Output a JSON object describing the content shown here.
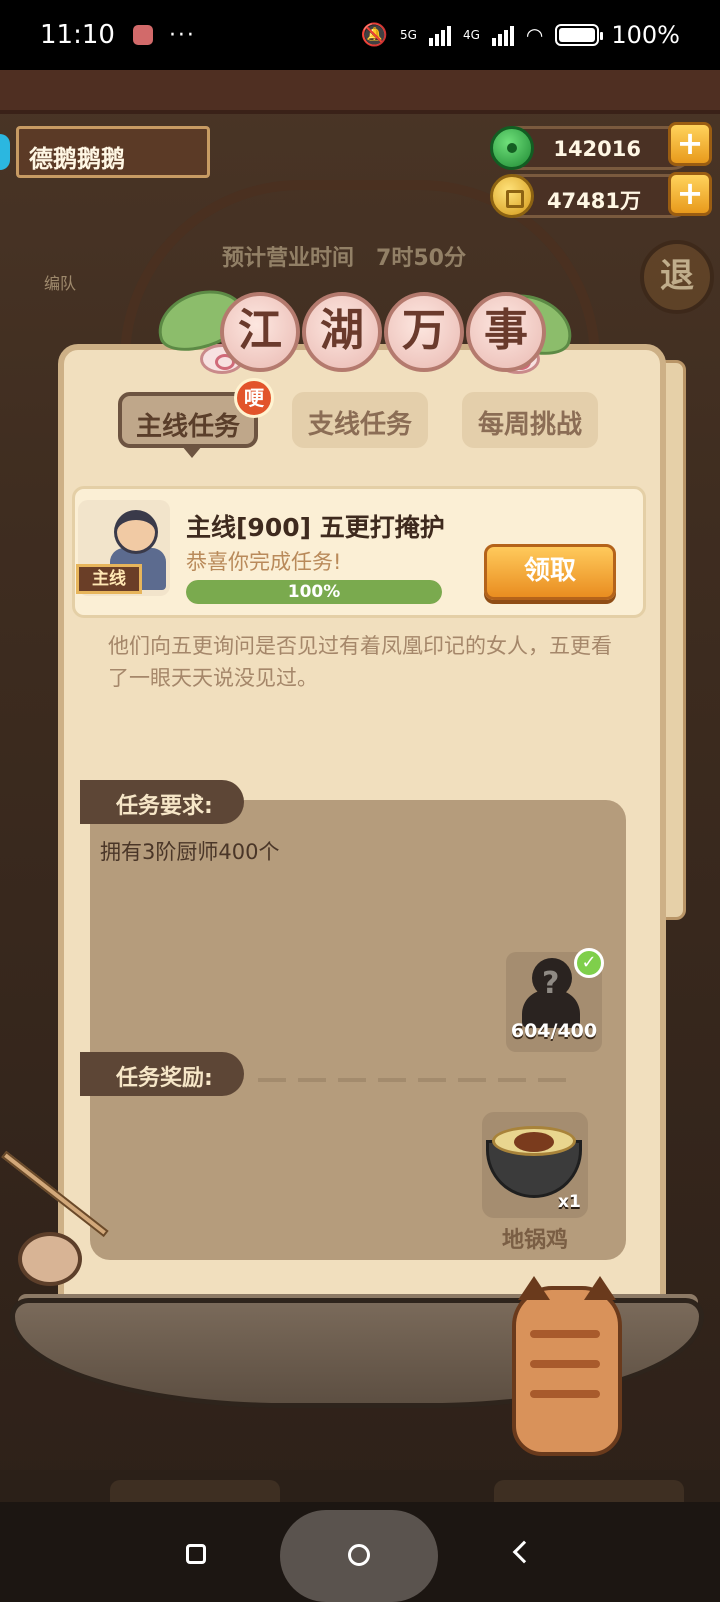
{
  "status_bar": {
    "time": "11:10",
    "dots": "···",
    "net1": "5G",
    "net2": "4G",
    "battery": "100%"
  },
  "header": {
    "player_name": "德鹅鹅鹅",
    "jade_amount": "142016",
    "gold_amount": "47481万",
    "plus": "+"
  },
  "background": {
    "team_label": "编队",
    "business_time_label": "预计营业时间",
    "business_time_value": "7时50分",
    "exit_label": "退"
  },
  "panel": {
    "title_chars": [
      "江",
      "湖",
      "万",
      "事"
    ],
    "tabs": [
      {
        "label": "主线任务",
        "active": true
      },
      {
        "label": "支线任务",
        "active": false
      },
      {
        "label": "每周挑战",
        "active": false
      }
    ],
    "badge": "哽",
    "quest": {
      "tag": "主线",
      "title": "主线[900] 五更打掩护",
      "subtitle": "恭喜你完成任务!",
      "progress_percent": 100,
      "progress_text": "100%",
      "claim_label": "领取"
    },
    "description": "他们向五更询问是否见过有着凤凰印记的女人，五更看了一眼天天说没见过。",
    "requirements": {
      "label": "任务要求:",
      "text": "拥有3阶厨师400个",
      "item_count": "604/400",
      "item_icon": "chef-silhouette-icon",
      "done": true
    },
    "rewards": {
      "label": "任务奖励:",
      "item_name": "地锅鸡",
      "item_qty": "x1",
      "item_icon": "dish-bowl-icon"
    }
  },
  "colors": {
    "panel": "#f1dfbe",
    "accent_orange": "#e98d20",
    "progress_green": "#7aaa4e",
    "section_brown": "#5d4636"
  }
}
